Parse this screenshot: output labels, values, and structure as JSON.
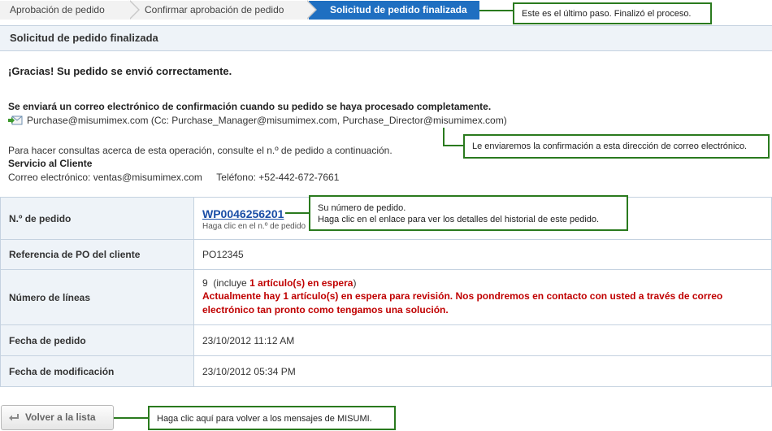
{
  "steps": [
    {
      "label": "Aprobación de pedido"
    },
    {
      "label": "Confirmar aprobación de pedido"
    },
    {
      "label": "Solicitud de pedido finalizada"
    }
  ],
  "callouts": {
    "step": "Este es el último paso. Finalizó el proceso.",
    "mail": "Le enviaremos la confirmación a esta dirección de correo electrónico.",
    "order_line1": "Su número de pedido.",
    "order_line2": "Haga clic en el enlace para ver los detalles del historial de este pedido.",
    "back": "Haga clic aquí para volver a los mensajes de MISUMI."
  },
  "section_title": "Solicitud de pedido finalizada",
  "thanks": "¡Gracias! Su pedido se envió correctamente.",
  "confirm_info": "Se enviará un correo electrónico de confirmación cuando su pedido se haya procesado completamente.",
  "email_line": "Purchase@misumimex.com (Cc: Purchase_Manager@misumimex.com, Purchase_Director@misumimex.com)",
  "consult_text": "Para hacer consultas acerca de esta operación, consulte el n.º de pedido a continuación.",
  "service": {
    "title": "Servicio al Cliente",
    "email": "Correo electrónico: ventas@misumimex.com",
    "phone": "Teléfono: +52-442-672-7661"
  },
  "table": {
    "order_no_label": "N.º de pedido",
    "order_no": "WP0046256201",
    "order_hint": "Haga clic en el n.º de pedido",
    "po_label": "Referencia de PO del cliente",
    "po": "PO12345",
    "lines_label": "Número de líneas",
    "lines_count": "9",
    "lines_paren_open": "(incluye",
    "lines_hold": "1 artículo(s) en espera",
    "lines_paren_close": ")",
    "lines_warning": "Actualmente hay 1 artículo(s) en espera para revisión. Nos pondremos en contacto con usted a través de correo electrónico tan pronto como tengamos una solución.",
    "order_date_label": "Fecha de pedido",
    "order_date": "23/10/2012 11:12 AM",
    "mod_date_label": "Fecha de modificación",
    "mod_date": "23/10/2012 05:34 PM"
  },
  "back_button": "Volver a la lista",
  "icons": {
    "mail": "mail-send-icon",
    "back": "return-arrow-icon"
  },
  "colors": {
    "step_active": "#1f6fc1",
    "callout_border": "#2a7a1e",
    "warning": "#c00000",
    "link": "#1a4ea6"
  }
}
